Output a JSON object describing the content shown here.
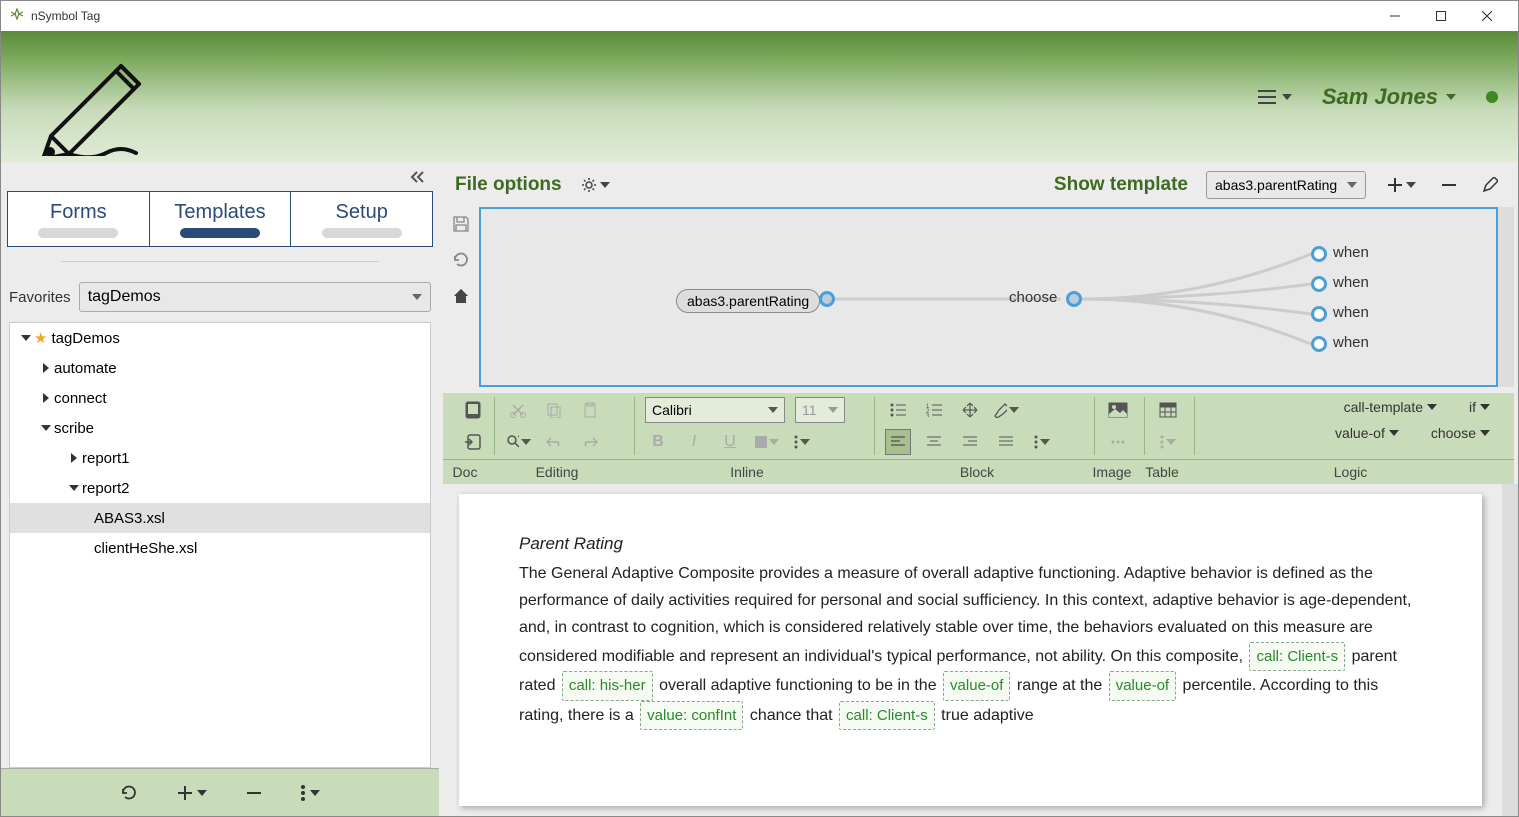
{
  "window": {
    "title": "nSymbol Tag"
  },
  "header": {
    "user": "Sam Jones"
  },
  "sidebar": {
    "tabs": [
      "Forms",
      "Templates",
      "Setup"
    ],
    "active_tab": 1,
    "favorites_label": "Favorites",
    "favorites_value": "tagDemos",
    "tree": {
      "root": "tagDemos",
      "items": [
        "automate",
        "connect",
        "scribe"
      ],
      "scribe_children": [
        "report1",
        "report2"
      ],
      "report2_children": [
        "ABAS3.xsl",
        "clientHeShe.xsl"
      ],
      "selected": "ABAS3.xsl"
    }
  },
  "toolbar": {
    "file_options": "File options",
    "show_template": "Show template",
    "template_value": "abas3.parentRating"
  },
  "diagram": {
    "root_node": "abas3.parentRating",
    "choose_node": "choose",
    "leaves": [
      "when",
      "when",
      "when",
      "when"
    ]
  },
  "ribbon": {
    "font": "Calibri",
    "size": "11",
    "groups": [
      "Doc",
      "Editing",
      "Inline",
      "Block",
      "Image",
      "Table",
      "Logic"
    ],
    "logic": [
      "call-template",
      "if",
      "value-of",
      "choose"
    ]
  },
  "document": {
    "heading": "Parent Rating",
    "p1a": "The General Adaptive Composite provides a measure of overall adaptive functioning. Adaptive behavior is defined as the performance of daily activities required for personal and social sufficiency. In this context, adaptive behavior is age-dependent, and, in contrast to cognition, which is considered relatively stable over time, the behaviors evaluated on this measure are considered modifiable and represent an individual's typical performance, not ability. On this composite, ",
    "t1": "call: Client-s",
    "p1b": " parent rated ",
    "t2": "call: his-her",
    "p1c": " overall adaptive functioning to be in the ",
    "t3": "value-of",
    "p1d": " range at the ",
    "t4": "value-of",
    "p1e": " percentile. According to this rating, there is a ",
    "t5": "value: confInt",
    "p1f": " chance that ",
    "t6": "call: Client-s",
    "p1g": " true adaptive"
  }
}
